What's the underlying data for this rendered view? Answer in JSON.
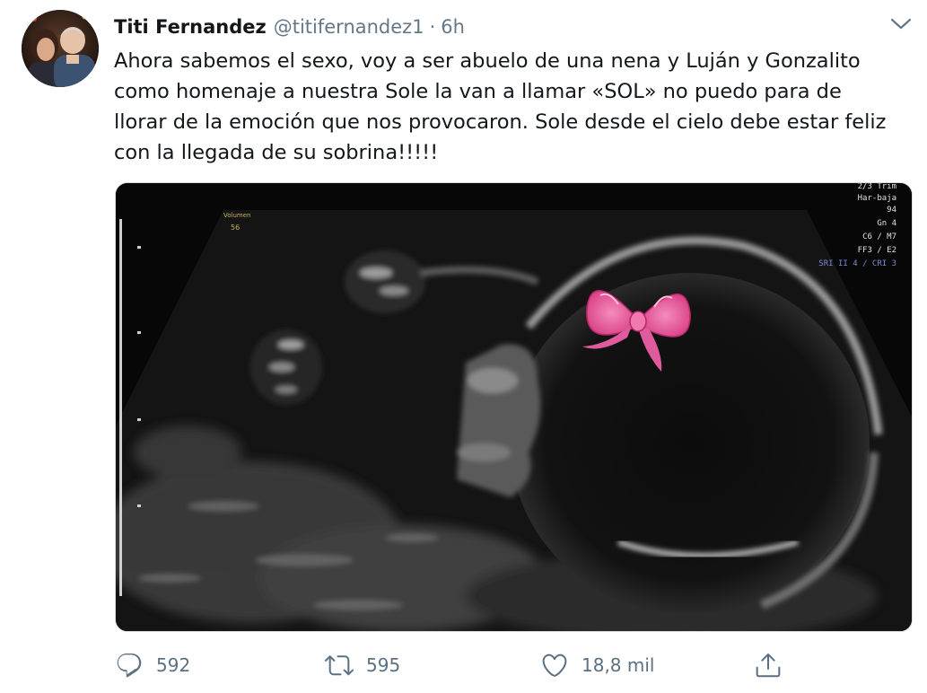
{
  "author": {
    "name": "Titi Fernandez",
    "handle": "@titifernandez1",
    "separator": "·",
    "timestamp": "6h"
  },
  "tweet": {
    "lines": [
      "Ahora sabemos el sexo, voy a ser abuelo de una nena y Luján y Gonzalito",
      "como homenaje a nuestra Sole la van a llamar «SOL» no puedo para de",
      "llorar de la emoción que nos provocaron. Sole desde el cielo debe estar feliz",
      "con la llegada de su sobrina!!!!!"
    ]
  },
  "media": {
    "type": "ultrasound-image",
    "overlay_left": [
      "Volumen",
      "56"
    ],
    "overlay_right": [
      "2/3 Trim",
      "Har-baja",
      "94",
      "Gn 4",
      "C6 / M7",
      "FF3 / E2",
      "SRI II 4 / CRI 3"
    ],
    "decoration_icon": "pink-bow-icon"
  },
  "actions": {
    "reply": {
      "icon": "reply-icon",
      "count": "592"
    },
    "retweet": {
      "icon": "retweet-icon",
      "count": "595"
    },
    "like": {
      "icon": "heart-icon",
      "count": "18,8 mil"
    },
    "share": {
      "icon": "share-icon"
    }
  },
  "colors": {
    "text": "#14171a",
    "secondary": "#657786",
    "action": "#5b7083",
    "bow": "#e85a9a"
  }
}
